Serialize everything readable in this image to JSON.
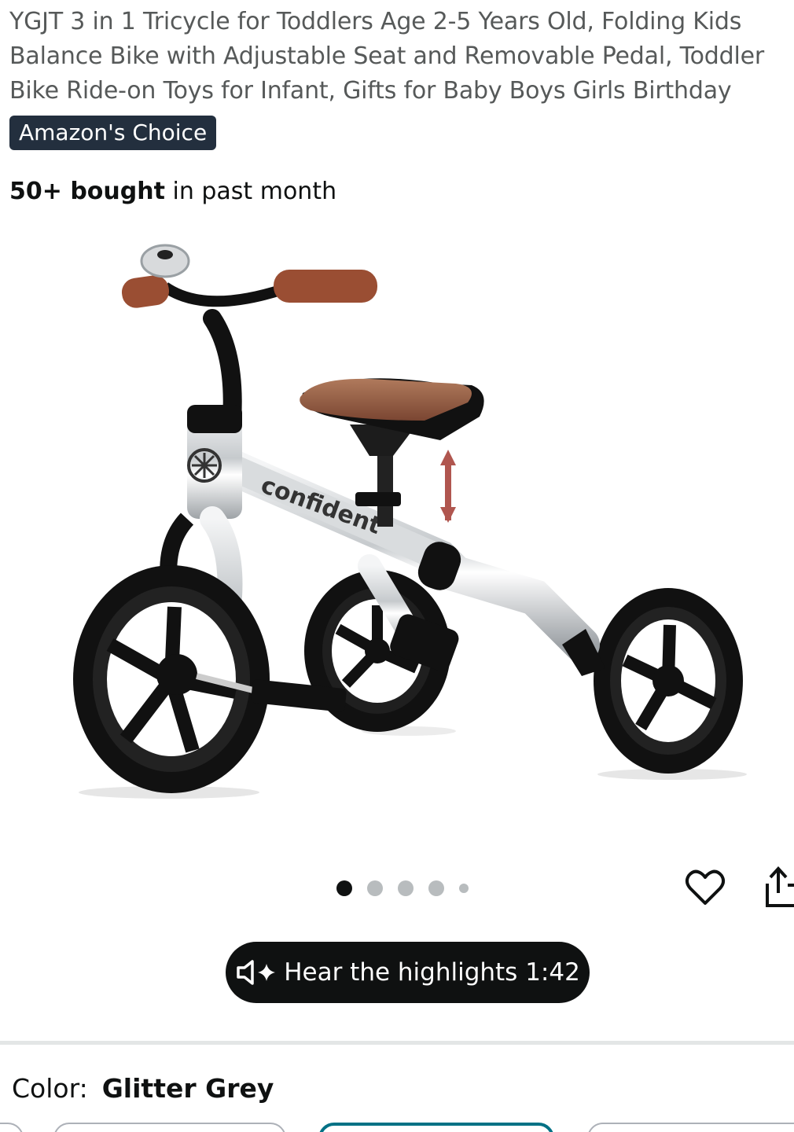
{
  "product": {
    "title": "YGJT 3 in 1 Tricycle for Toddlers Age 2-5 Years Old, Folding Kids Balance Bike with Adjustable Seat and Removable Pedal, Toddler Bike Ride-on Toys for Infant, Gifts for Baby Boys Girls Birthday",
    "badge": "Amazon's Choice",
    "bought_count": "50+ bought",
    "bought_suffix": " in past month",
    "image_brand_text": "confident"
  },
  "gallery": {
    "images_total": 5,
    "active_index": 0
  },
  "actions": {
    "hear_highlights_label": "Hear the highlights 1:42"
  },
  "variation": {
    "color_label": "Color:",
    "color_value": "Glitter Grey"
  },
  "colors": {
    "badge_bg": "#232f3e",
    "pill_bg": "#0f1111",
    "selected_swatch": "#007185",
    "arrow": "#b0564f"
  },
  "icons": [
    "heart-icon",
    "share-icon",
    "speaker-sparkle-icon"
  ]
}
